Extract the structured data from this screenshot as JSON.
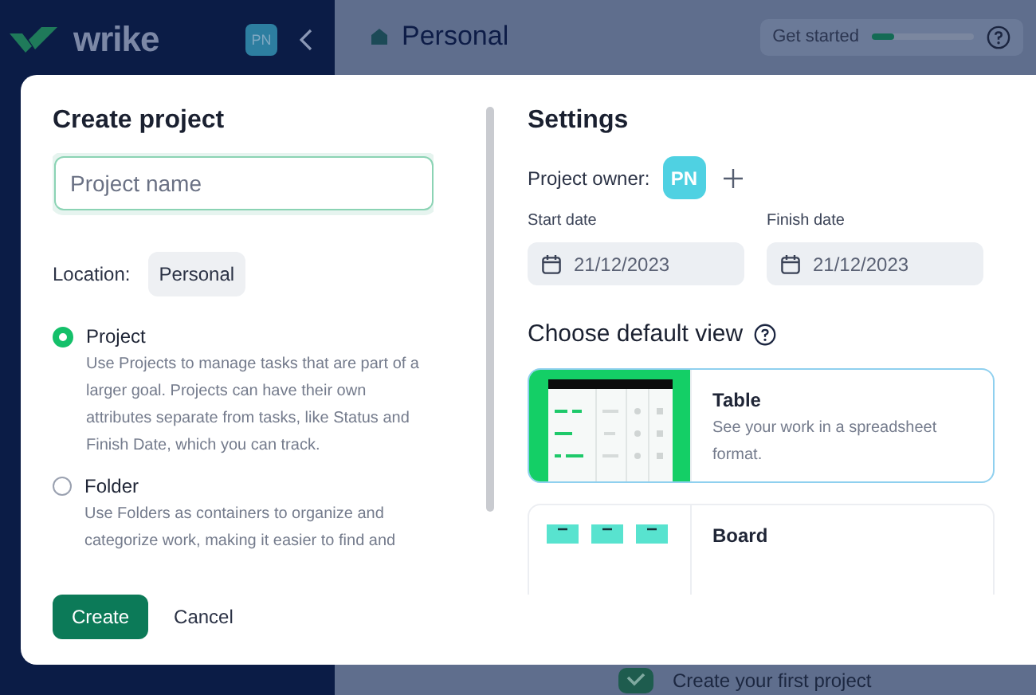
{
  "sidebar": {
    "logo": "wrike",
    "avatar": "PN"
  },
  "header": {
    "title": "Personal",
    "get_started": {
      "label": "Get started",
      "level": 0.22
    }
  },
  "onboarding": {
    "label": "Create your first project"
  },
  "dialog": {
    "title": "Create project",
    "name_field": {
      "placeholder": "Project name"
    },
    "location": {
      "label": "Location:",
      "value": "Personal"
    },
    "types": [
      {
        "label": "Project",
        "description": "Use Projects to manage tasks that are part of a larger goal. Projects can have their own attributes separate from tasks, like Status and Finish Date, which you can track.",
        "selected": true
      },
      {
        "label": "Folder",
        "description": "Use Folders as containers to organize and categorize work, making it easier to find and",
        "selected": false
      }
    ],
    "buttons": {
      "primary": "Create",
      "secondary": "Cancel"
    },
    "settings": {
      "title": "Settings",
      "owner_label": "Project owner:",
      "owner_avatar": "PN",
      "dates": [
        {
          "label": "Start date",
          "value": "21/12/2023"
        },
        {
          "label": "Finish date",
          "value": "21/12/2023"
        }
      ],
      "view_title": "Choose default view",
      "views": [
        {
          "kind": "table",
          "name": "Table",
          "description": "See your work in a spreadsheet format.",
          "selected": true
        },
        {
          "kind": "board",
          "name": "Board",
          "selected": false
        }
      ]
    }
  }
}
